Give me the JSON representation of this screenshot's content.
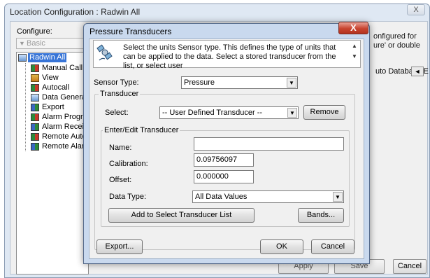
{
  "background_window": {
    "title": "Location Configuration : Radwin All",
    "close_glyph": "X",
    "configure_label": "Configure:",
    "configure_value": "Basic",
    "tree": {
      "root": "Radwin All",
      "items": [
        {
          "label": "Manual Call",
          "icon": "alarm-app-icon"
        },
        {
          "label": "View",
          "icon": "view-icon"
        },
        {
          "label": "Autocall",
          "icon": "autocall-icon"
        },
        {
          "label": "Data Generat",
          "icon": "data-generator-icon"
        },
        {
          "label": "Export",
          "icon": "export-icon"
        },
        {
          "label": "Alarm Progra",
          "icon": "alarm-program-icon"
        },
        {
          "label": "Alarm Receive",
          "icon": "alarm-receive-icon"
        },
        {
          "label": "Remote Autoc",
          "icon": "remote-autocall-icon"
        },
        {
          "label": "Remote Alarm",
          "icon": "remote-alarm-icon"
        }
      ]
    },
    "right_text_line1": "onfigured for",
    "right_text_line2": "ure' or double",
    "auto_db_label": "uto Database E",
    "auto_db_btn": "◄",
    "bottom_btn_1": "Apply",
    "bottom_btn_2": "Save",
    "cancel_button": "Cancel"
  },
  "dialog": {
    "title": "Pressure Transducers",
    "close_glyph": "X",
    "info_text": "Select the units Sensor type. This defines the type of units that can be applied to the data. Select a stored transducer from the list, or select user",
    "sensor_type_label": "Sensor Type:",
    "sensor_type_value": "Pressure",
    "transducer_group": "Transducer",
    "select_label": "Select:",
    "select_value": "-- User Defined Transducer --",
    "remove_button": "Remove",
    "edit_group": "Enter/Edit Transducer",
    "name_label": "Name:",
    "name_value": "",
    "calibration_label": "Calibration:",
    "calibration_value": "0.09756097",
    "offset_label": "Offset:",
    "offset_value": "0.000000",
    "data_type_label": "Data Type:",
    "data_type_value": "All Data Values",
    "add_button": "Add to Select Transducer List",
    "bands_button": "Bands...",
    "export_button": "Export...",
    "ok_button": "OK",
    "cancel_button": "Cancel"
  },
  "colors": {
    "selection": "#3875d7",
    "close_red": "#c8442f",
    "window_frame": "#c9d9ee"
  }
}
